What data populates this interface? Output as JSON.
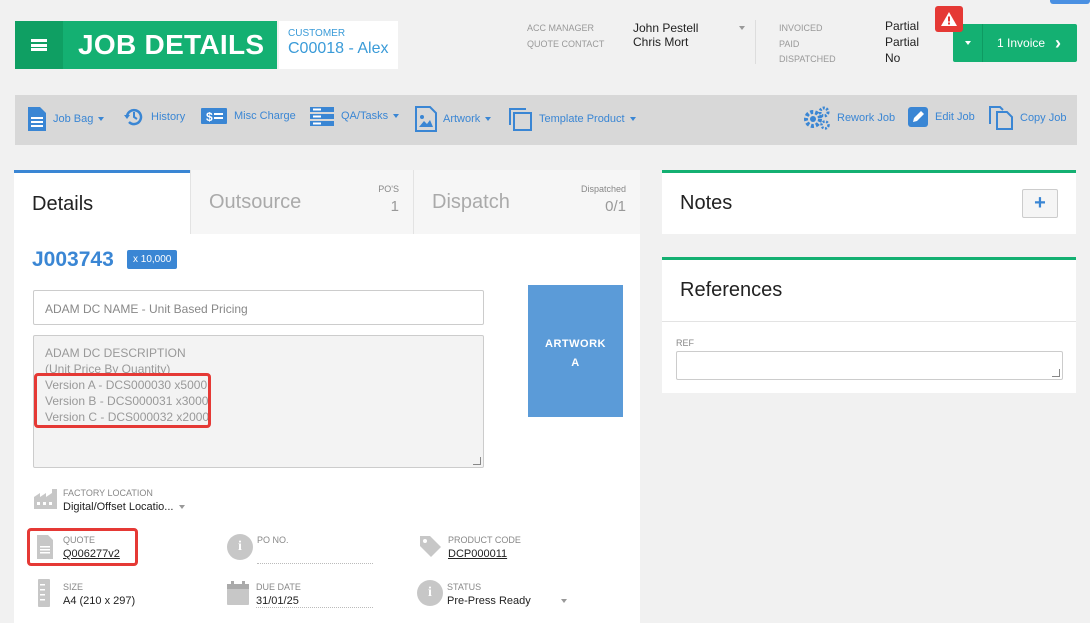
{
  "header": {
    "title": "JOB DETAILS",
    "customer_label": "CUSTOMER",
    "customer_value": "C00018 - Alex",
    "acc_manager_label": "ACC MANAGER",
    "acc_manager_value": "John Pestell",
    "quote_contact_label": "QUOTE CONTACT",
    "quote_contact_value": "Chris Mort",
    "invoiced_label": "INVOICED",
    "invoiced_value": "Partial",
    "paid_label": "PAID",
    "paid_value": "Partial",
    "dispatched_label": "DISPATCHED",
    "dispatched_value": "No",
    "invoice_button": "1 Invoice"
  },
  "toolbar": {
    "job_bag": "Job Bag",
    "history": "History",
    "misc_charge": "Misc Charge",
    "qa_tasks": "QA/Tasks",
    "artwork": "Artwork",
    "template_product": "Template Product",
    "rework_job": "Rework Job",
    "edit_job": "Edit Job",
    "copy_job": "Copy Job"
  },
  "tabs": {
    "details": "Details",
    "outsource": "Outsource",
    "outsource_meta_label": "PO'S",
    "outsource_meta_value": "1",
    "dispatch": "Dispatch",
    "dispatch_meta_label": "Dispatched",
    "dispatch_meta_value": "0/1"
  },
  "job": {
    "number": "J003743",
    "qty_badge": "x 10,000",
    "name": "ADAM DC NAME - Unit Based Pricing",
    "description_lines": [
      "ADAM DC DESCRIPTION",
      "(Unit Price By Quantity)",
      "Version A - DCS000030 x5000",
      "Version B - DCS000031 x3000",
      "Version C - DCS000032 x2000"
    ],
    "artwork_line1": "ARTWORK",
    "artwork_line2": "A"
  },
  "fields": {
    "factory_location_label": "FACTORY LOCATION",
    "factory_location_value": "Digital/Offset Locatio...",
    "quote_label": "QUOTE",
    "quote_value": "Q006277v2",
    "po_no_label": "PO NO.",
    "po_no_value": "",
    "product_code_label": "PRODUCT CODE",
    "product_code_value": "DCP000011",
    "size_label": "SIZE",
    "size_value": "A4 (210 x 297)",
    "due_date_label": "DUE DATE",
    "due_date_value": "31/01/25",
    "status_label": "STATUS",
    "status_value": "Pre-Press Ready"
  },
  "notes": {
    "title": "Notes",
    "add_symbol": "+"
  },
  "references": {
    "title": "References",
    "ref_label": "REF",
    "ref_value": ""
  },
  "colors": {
    "brand_green": "#14b072",
    "link_blue": "#3a86d4",
    "alert_red": "#e53935",
    "artwork_blue": "#5b9bd8"
  }
}
